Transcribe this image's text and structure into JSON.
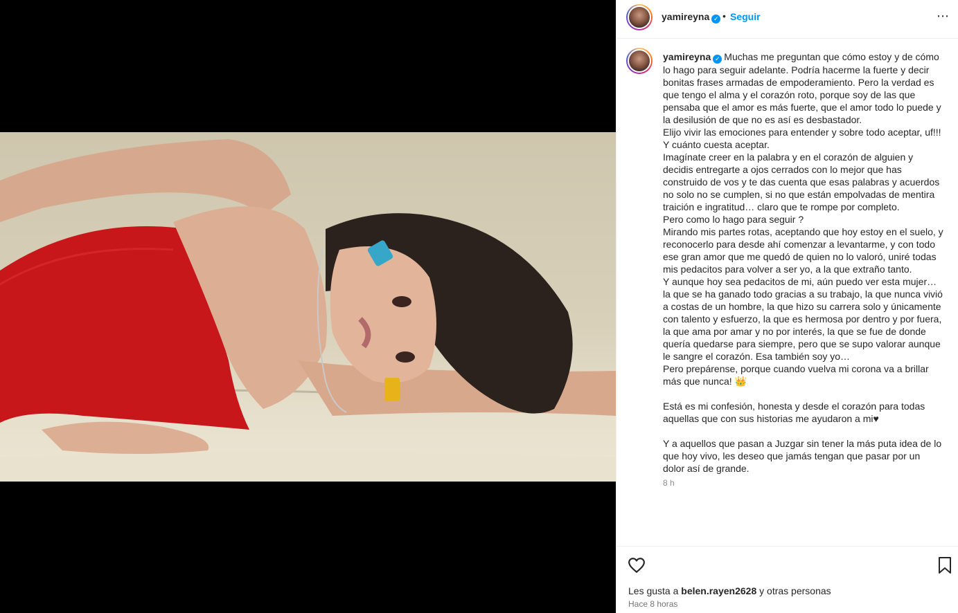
{
  "post": {
    "username": "yamireyna",
    "verified_icon": "verified-badge-icon",
    "follow_label": "Seguir",
    "separator": "•",
    "more_label": "⋯",
    "caption": "Muchas me preguntan que cómo estoy y de cómo lo hago para seguir adelante. Podría hacerme la fuerte y decir bonitas frases armadas de empoderamiento. Pero la verdad es que tengo el alma y el corazón roto, porque soy de las que pensaba que el amor es más fuerte, que el amor todo lo puede y la desilusión de que no es así es desbastador.\nElijo vivir las emociones para entender y sobre todo aceptar, uf!!! Y cuánto cuesta aceptar.\nImagínate creer en la palabra y en el corazón de alguien y decidis entregarte a ojos cerrados con lo mejor que has construido de vos y te das cuenta que esas palabras y acuerdos no solo no se cumplen, si no que están empolvadas de mentira traición e ingratitud… claro que te rompe por completo.\nPero como lo hago para seguir ?\nMirando mis partes rotas, aceptando que hoy estoy en el suelo, y reconocerlo para desde ahí comenzar a levantarme, y con todo ese gran amor que me quedó de quien no lo valoró, uniré todas mis pedacitos para volver a ser yo, a la que extraño tanto.\nY aunque hoy sea pedacitos de mi, aún puedo ver esta mujer… la que se ha ganado todo gracias a su trabajo, la que nunca vivió a costas de un hombre, la que hizo su carrera solo y únicamente con talento y esfuerzo, la que es hermosa por dentro y por fuera, la que ama por amar y no por interés, la que se fue de donde quería quedarse para siempre, pero que se supo valorar aunque le sangre el corazón. Esa también soy yo…\nPero prepárense, porque cuando vuelva mi corona va a brillar más que nunca! 👑\n\nEstá es mi confesión, honesta y desde el corazón para todas aquellas que con sus historias me ayudaron a mi♥\n\nY a aquellos que pasan a Juzgar sin tener la más puta idea de lo que hoy vivo, les deseo que jamás tengan que pasar por un dolor así de grande.",
    "caption_time": "8 h",
    "likes_prefix": "Les gusta a ",
    "likes_user": "belen.rayen2628",
    "likes_suffix": " y otras personas",
    "posted_ago": "Hace 8 horas"
  }
}
